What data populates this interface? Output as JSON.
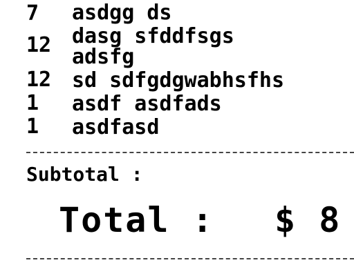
{
  "items": [
    {
      "qty": "7",
      "desc": "asdgg ds"
    },
    {
      "qty": "12",
      "desc_line1": "dasg sfddfsgs",
      "desc_line2": "adsfg"
    },
    {
      "qty": "12",
      "desc": "sd sdfgdgwabhsfhs"
    },
    {
      "qty": "1",
      "desc": "asdf asdfads"
    },
    {
      "qty": "1",
      "desc": "asdfasd"
    }
  ],
  "subtotal_label": "Subtotal :",
  "total_label": "Total :",
  "total_value": "$ 8"
}
